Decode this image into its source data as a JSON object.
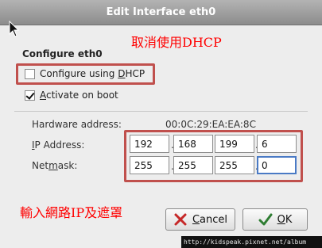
{
  "window": {
    "title": "Edit Interface eth0"
  },
  "annotations": {
    "dhcp_note": "取消使用DHCP",
    "ip_note": "輸入網路IP及遮罩"
  },
  "config": {
    "section_title": "Configure eth0",
    "dhcp_label_pre": "Configure using ",
    "dhcp_label_mn": "D",
    "dhcp_label_post": "HCP",
    "dhcp_checked": false,
    "boot_label_mn": "A",
    "boot_label_post": "ctivate on boot",
    "boot_checked": true,
    "hw_label": "Hardware address:",
    "hw_value": "00:0C:29:EA:EA:8C",
    "ip_label_mn": "I",
    "ip_label_post": "P Address:",
    "ip": [
      "192",
      "168",
      "199",
      "6"
    ],
    "mask_label_pre": "Net",
    "mask_label_mn": "m",
    "mask_label_post": "ask:",
    "mask": [
      "255",
      "255",
      "255",
      "0"
    ]
  },
  "buttons": {
    "cancel_mn": "C",
    "cancel_post": "ancel",
    "ok_mn": "O",
    "ok_post": "K"
  },
  "watermark": "http://kidspeak.pixnet.net/album"
}
